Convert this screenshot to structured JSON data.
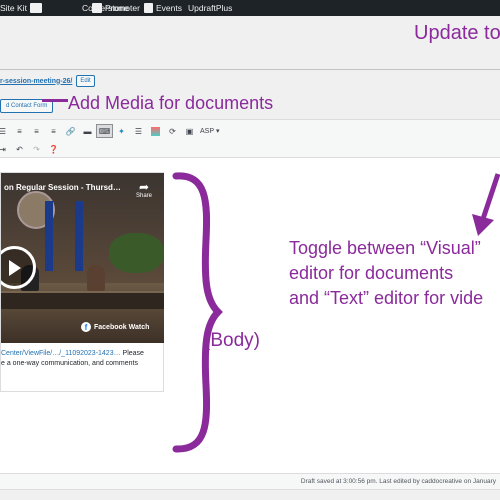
{
  "adminbar": {
    "items": [
      {
        "label": "Site Kit",
        "icon": "sitekit-icon"
      },
      {
        "label": "Cornerstone",
        "icon": "cornerstone-icon"
      },
      {
        "label": "Promoter",
        "icon": "promoter-icon"
      },
      {
        "label": "Events",
        "icon": "calendar-icon"
      },
      {
        "label": "UpdraftPlus",
        "icon": ""
      }
    ]
  },
  "annotations": {
    "update": "Update to",
    "add_media": "Add Media for documents",
    "toggle_line1": "Toggle between “Visual”",
    "toggle_line2": "editor for documents",
    "toggle_line3": "and “Text” editor for vide",
    "body_label": "(Body)",
    "color": "#8a2a9b"
  },
  "permalink": {
    "slug": "r-session-meeting-26/",
    "edit_label": "Edit"
  },
  "media_buttons": {
    "contact_form": "d Contact Form"
  },
  "toolbar": {
    "row1_icons": [
      "text-align-icon",
      "align-left-icon",
      "align-center-icon",
      "align-right-icon",
      "link-icon",
      "horizontal-rule-icon",
      "keyboard-icon",
      "brand-icon",
      "layers-icon",
      "color-block-icon",
      "sync-icon",
      "embed-icon"
    ],
    "asp_label": "ASP",
    "row2_icons": [
      "indent-icon",
      "undo-icon",
      "redo-icon",
      "help-icon"
    ]
  },
  "embed": {
    "title": "on Regular Session - Thursd…",
    "share_label": "Share",
    "watch_label": "Facebook Watch",
    "caption_link": "Center/ViewFile/…/_11092023-1423…",
    "caption_text_1": " Please",
    "caption_text_2": "e a one-way communication, and comments"
  },
  "status": {
    "text": "Draft saved at 3:00:56 pm. Last edited by caddocreative on January"
  }
}
